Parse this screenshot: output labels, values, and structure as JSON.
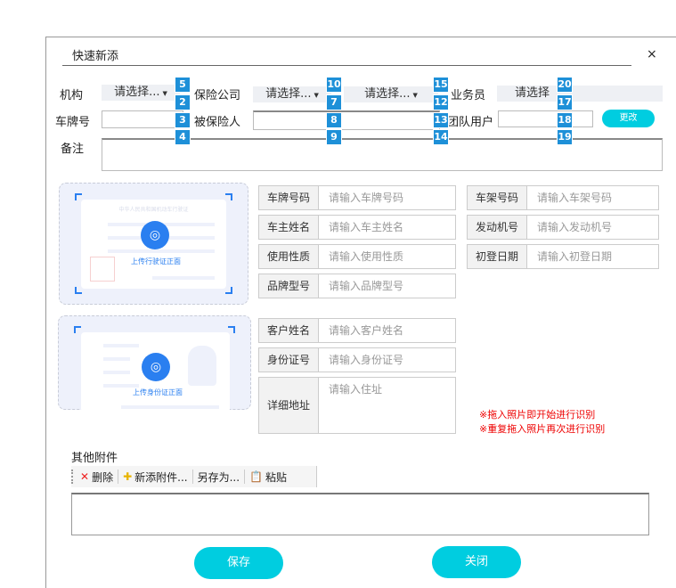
{
  "dialog": {
    "title": "快速新添",
    "close": "×"
  },
  "row1": {
    "org_label": "机构",
    "org_select": "请选择...",
    "ins_label": "保险公司",
    "ins_select1": "请选择...",
    "ins_select2": "请选择...",
    "staff_label": "业务员",
    "staff_select": "请选择"
  },
  "row2": {
    "plate_label": "车牌号",
    "insured_label": "被保险人",
    "team_label": "团队用户",
    "change_button": "更改"
  },
  "row3": {
    "remark_label": "备注"
  },
  "badges": {
    "c1": [
      "5",
      "2",
      "3",
      "4"
    ],
    "c2": [
      "10",
      "7",
      "8",
      "9"
    ],
    "c3": [
      "15",
      "12",
      "13",
      "14"
    ],
    "c4": [
      "20",
      "17",
      "18",
      "19"
    ]
  },
  "upload": {
    "vehicle": {
      "text": "上传行驶证正面",
      "doc_title": "中华人民共和国机动车行驶证"
    },
    "id": {
      "text": "上传身份证正面"
    }
  },
  "vehicle_fields": [
    {
      "label": "车牌号码",
      "placeholder": "请输入车牌号码"
    },
    {
      "label": "车主姓名",
      "placeholder": "请输入车主姓名"
    },
    {
      "label": "使用性质",
      "placeholder": "请输入使用性质"
    },
    {
      "label": "品牌型号",
      "placeholder": "请输入品牌型号"
    }
  ],
  "vehicle_fields_right": [
    {
      "label": "车架号码",
      "placeholder": "请输入车架号码"
    },
    {
      "label": "发动机号",
      "placeholder": "请输入发动机号"
    },
    {
      "label": "初登日期",
      "placeholder": "请输入初登日期"
    }
  ],
  "customer_fields": [
    {
      "label": "客户姓名",
      "placeholder": "请输入客户姓名"
    },
    {
      "label": "身份证号",
      "placeholder": "请输入身份证号"
    },
    {
      "label": "详细地址",
      "placeholder": "请输入住址"
    }
  ],
  "notes": [
    "※拖入照片即开始进行识别",
    "※重复拖入照片再次进行识别"
  ],
  "attachments": {
    "label": "其他附件",
    "delete": "删除",
    "add": "新添附件...",
    "save_as": "另存为...",
    "paste": "粘贴"
  },
  "footer": {
    "save": "保存",
    "close": "关闭"
  }
}
